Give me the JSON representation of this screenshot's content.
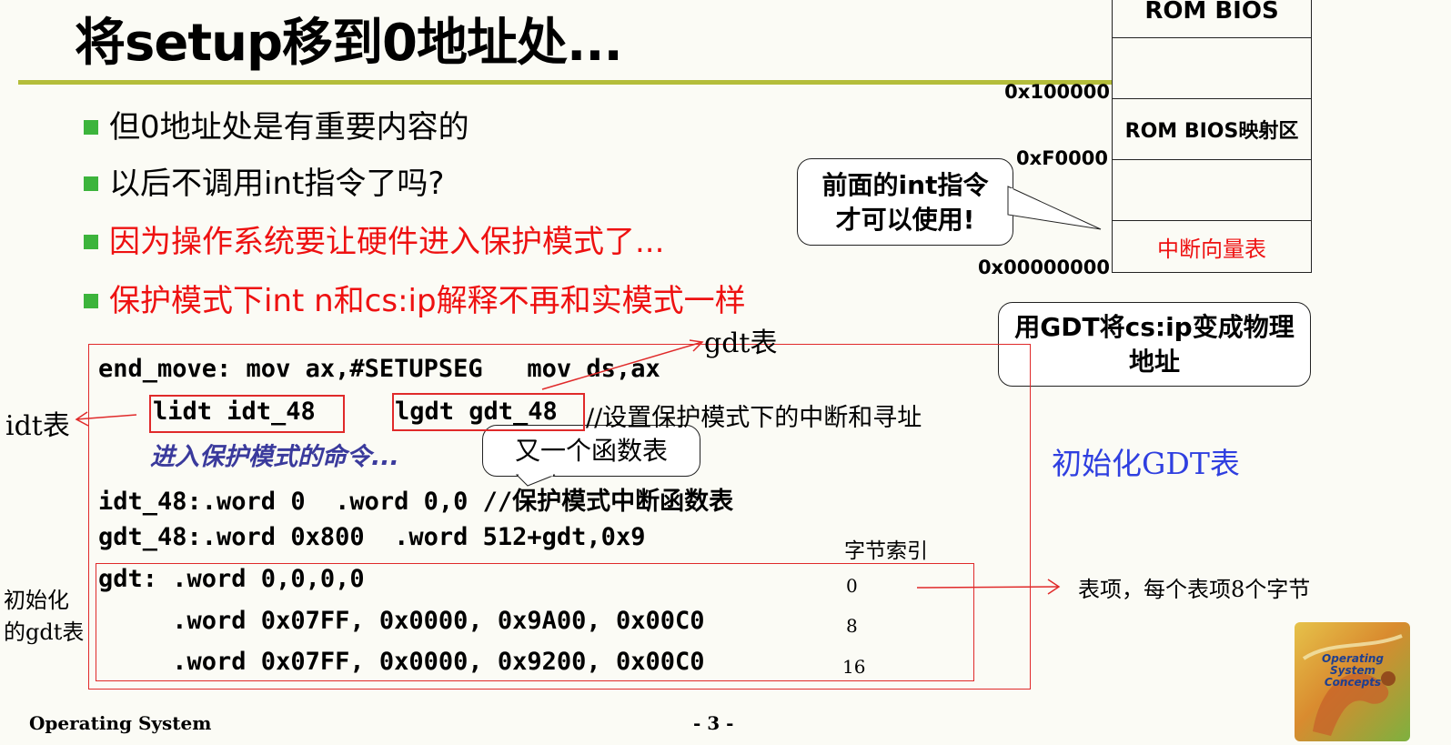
{
  "slide": {
    "title": "将setup移到0地址处...",
    "bullets": [
      {
        "text": "但0地址处是有重要内容的",
        "color": "#000000"
      },
      {
        "text": "以后不调用int指令了吗?",
        "color": "#000000"
      },
      {
        "text": "因为操作系统要让硬件进入保护模式了...",
        "color": "#ee1111"
      },
      {
        "text": "保护模式下int n和cs:ip解释不再和实模式一样",
        "color": "#ee1111"
      }
    ],
    "accent_rule_color": "#b4bd3a",
    "bullet_color": "#3cb43c"
  },
  "memory_map": {
    "cells": [
      "ROM BIOS",
      "",
      "ROM BIOS映射区",
      "",
      "中断向量表"
    ],
    "addresses": [
      "0x100000",
      "0xF0000",
      "0x00000000"
    ]
  },
  "callouts": {
    "int_usable": "前面的int指令才可以使用!",
    "gdt_physical": "用GDT将cs:ip变成物理地址",
    "another_table": "又一个函数表"
  },
  "labels": {
    "gdt_table": "gdt表",
    "idt_table": "idt表",
    "init_gdt_table": "初始化GDT表",
    "init_gdt_left": "初始化的gdt表",
    "byte_index": "字节索引",
    "byte_index_values": [
      "0",
      "8",
      "16"
    ],
    "entry_note": "表项，每个表项8个字节"
  },
  "code": {
    "line1": "end_move: mov ax,#SETUPSEG   mov ds,ax",
    "lidt": "lidt idt_48",
    "lgdt": "lgdt gdt_48",
    "line2_comment": "//设置保护模式下的中断和寻址",
    "line3": "进入保护模式的命令...",
    "line4": "idt_48:.word 0  .word 0,0 //保护模式中断函数表",
    "line5": "gdt_48:.word 0x800  .word 512+gdt,0x9",
    "line6": "gdt: .word 0,0,0,0",
    "line7": "     .word 0x07FF, 0x0000, 0x9A00, 0x00C0",
    "line8": "     .word 0x07FF, 0x0000, 0x9200, 0x00C0"
  },
  "footer": {
    "left": "Operating System",
    "page": "- 3 -"
  },
  "logo": {
    "text": "Operating System Concepts"
  }
}
